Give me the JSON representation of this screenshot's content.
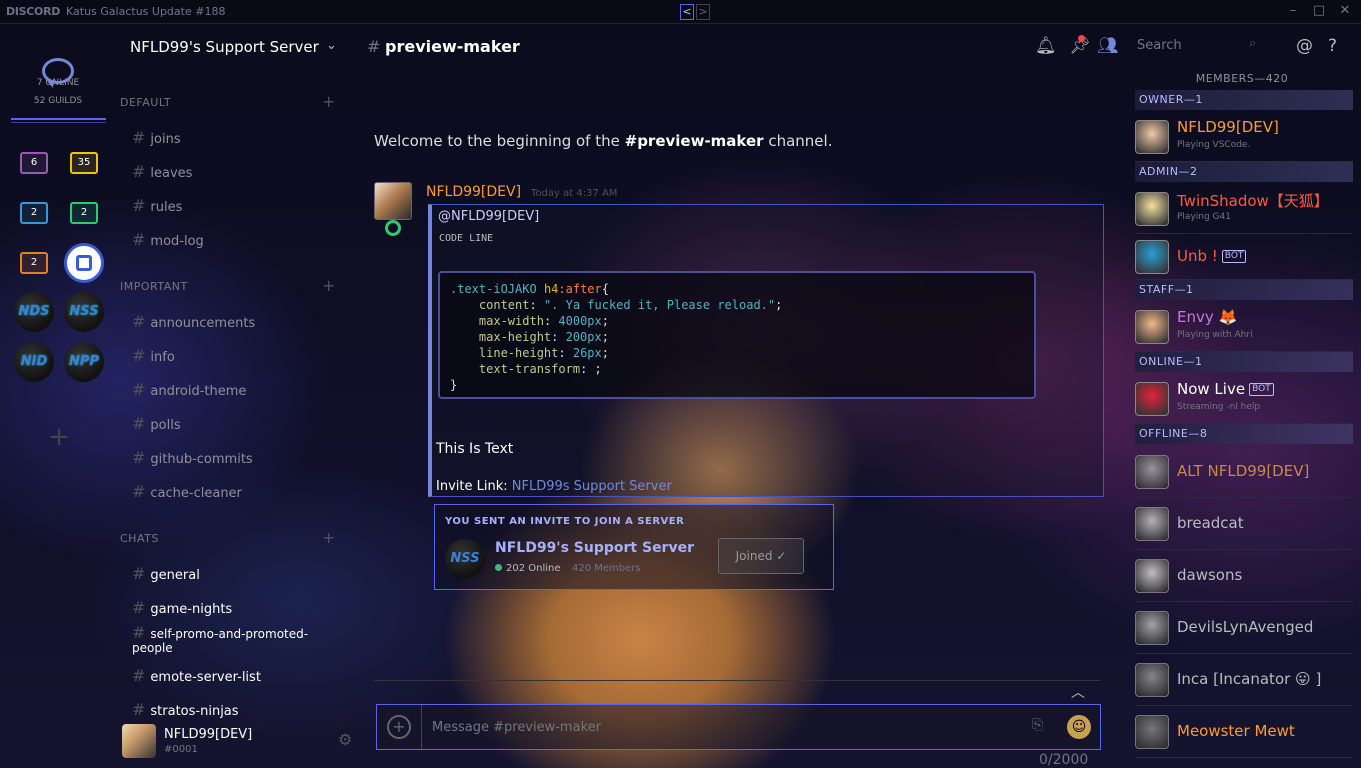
{
  "titlebar": {
    "logo": "DISCORD",
    "title": "Katus Galactus Update #188",
    "back": "<",
    "forward": ">"
  },
  "guilds": {
    "online": "7 ONLINE",
    "count": "52 GUILDS",
    "folders": [
      {
        "label": "6",
        "color": "#9b59b6"
      },
      {
        "label": "35",
        "color": "#f1c40f"
      },
      {
        "label": "2",
        "color": "#3498db"
      },
      {
        "label": "2",
        "color": "#2ecc71"
      },
      {
        "label": "2",
        "color": "#e67e22"
      }
    ],
    "servers": [
      "NDS",
      "NSS",
      "NID",
      "NPP"
    ]
  },
  "server": {
    "name": "NFLD99's Support Server",
    "categories": [
      {
        "name": "DEFAULT",
        "channels": [
          "joins",
          "leaves",
          "rules",
          "mod-log"
        ]
      },
      {
        "name": "IMPORTANT",
        "channels": [
          "announcements",
          "info",
          "android-theme",
          "polls",
          "github-commits",
          "cache-cleaner"
        ]
      },
      {
        "name": "CHATS",
        "channels": [
          "general",
          "game-nights",
          "self-promo-and-promoted-people",
          "emote-server-list",
          "stratos-ninjas"
        ]
      }
    ]
  },
  "user": {
    "name": "NFLD99[DEV]",
    "tag": "#0001"
  },
  "header": {
    "channel": "preview-maker",
    "search_placeholder": "Search"
  },
  "main": {
    "welcome_prefix": "Welcome to the beginning of the ",
    "welcome_channel": "#preview-maker",
    "welcome_suffix": " channel.",
    "message": {
      "author": "NFLD99[DEV]",
      "time": "Today at 4:37 AM",
      "mention": "@NFLD99[DEV]",
      "code_line": "CODE LINE",
      "code": {
        "selector": ".text-iOJAKO",
        "tag": "h4",
        "pseudo": ":after",
        "brace_open": "{",
        "brace_close": "}",
        "props": [
          {
            "name": "content",
            "value": "\". Ya fucked it, Please reload.\""
          },
          {
            "name": "max-width",
            "value": "4000px"
          },
          {
            "name": "max-height",
            "value": "200px"
          },
          {
            "name": "line-height",
            "value": "26px"
          },
          {
            "name": "text-transform",
            "value": ""
          }
        ]
      },
      "text": "This Is Text",
      "invite_label": "Invite Link: ",
      "invite_link": "NFLD99s Support Server"
    },
    "invite": {
      "title": "YOU SENT AN INVITE TO JOIN A SERVER",
      "icon": "NSS",
      "server": "NFLD99's Support Server",
      "online": "202 Online",
      "members": "420 Members",
      "button": "Joined ✓"
    },
    "input": {
      "placeholder": "Message #preview-maker",
      "counter": "0/2000"
    }
  },
  "members": {
    "title": "MEMBERS—420",
    "groups": [
      {
        "role": "OWNER—1",
        "list": [
          {
            "name": "NFLD99[DEV]",
            "color": "#ff9b2e",
            "activity": "Playing VSCode."
          }
        ]
      },
      {
        "role": "ADMIN—2",
        "list": [
          {
            "name": "TwinShadow【天狐】",
            "color": "#ff5a3c",
            "activity": "Playing G41"
          },
          {
            "name": "Unb !",
            "color": "#ff5a3c",
            "bot": "BOT"
          }
        ]
      },
      {
        "role": "STAFF—1",
        "list": [
          {
            "name": "Envy 🦊",
            "color": "#c678dd",
            "activity": "Playing with Ahri"
          }
        ]
      },
      {
        "role": "ONLINE—1",
        "list": [
          {
            "name": "Now Live",
            "color": "#ffffff",
            "bot": "BOT",
            "activity": "Streaming -nl help"
          }
        ]
      },
      {
        "role": "OFFLINE—8",
        "list": [
          {
            "name": "ALT NFLD99[DEV]",
            "color": "#c88a4a"
          },
          {
            "name": "breadcat",
            "color": "#b9bbbe"
          },
          {
            "name": "dawsons",
            "color": "#b9bbbe"
          },
          {
            "name": "DevilsLynAvenged",
            "color": "#b9bbbe"
          },
          {
            "name": "Inca [Incanator 😛 ]",
            "color": "#b9bbbe"
          },
          {
            "name": "Meowster Mewt",
            "color": "#ff9b2e"
          }
        ]
      }
    ]
  }
}
